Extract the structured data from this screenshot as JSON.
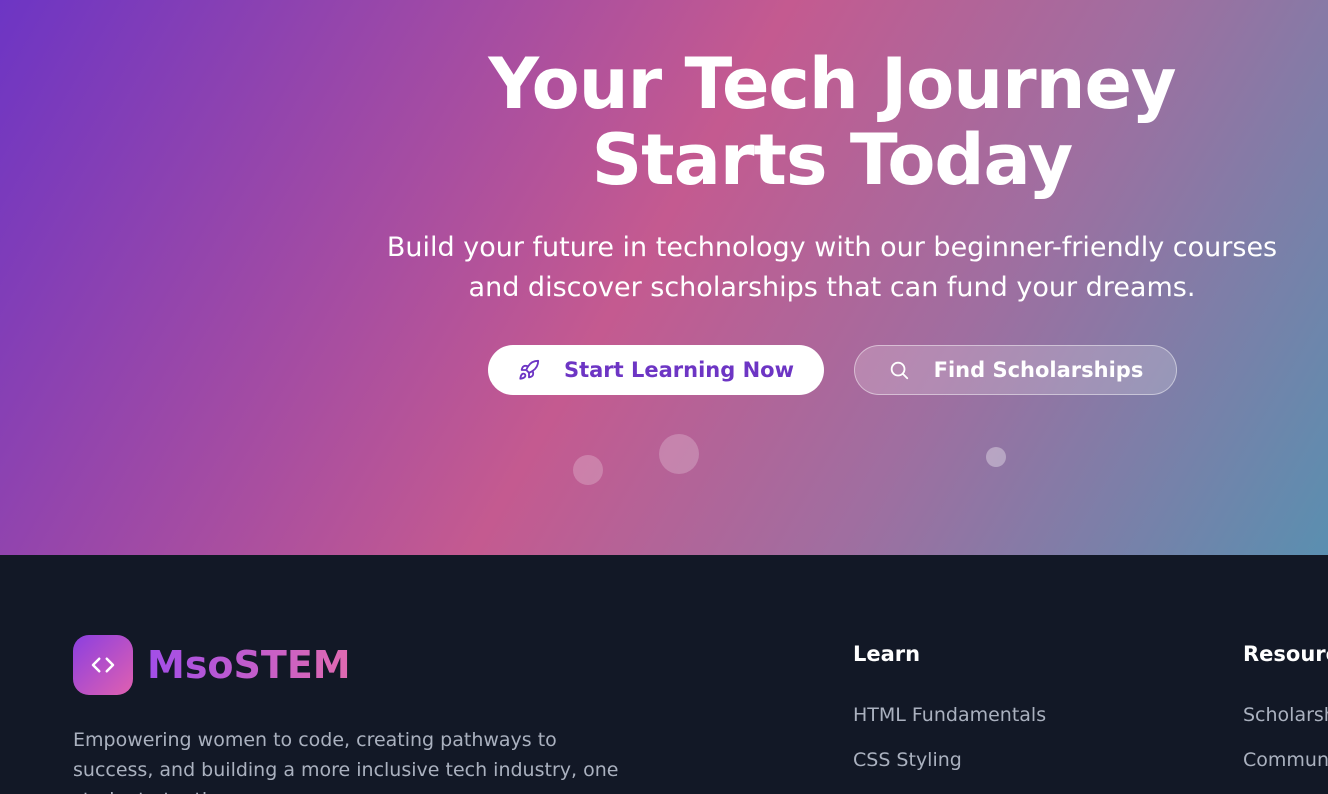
{
  "hero": {
    "title_line1": "Your Tech Journey",
    "title_line2": "Starts Today",
    "subtitle_line1": "Build your future in technology with our beginner-friendly courses",
    "subtitle_line2": "and discover scholarships that can fund your dreams.",
    "primary_button": {
      "label": "Start Learning Now",
      "icon": "rocket-icon"
    },
    "secondary_button": {
      "label": "Find Scholarships",
      "icon": "search-icon"
    }
  },
  "footer": {
    "brand": {
      "name": "MsoSTEM",
      "icon": "code-icon"
    },
    "tagline": "Empowering women to code, creating pathways to success, and building a more inclusive tech industry, one student at a time.",
    "columns": [
      {
        "title": "Learn",
        "links": [
          "HTML Fundamentals",
          "CSS Styling"
        ]
      },
      {
        "title": "Resources",
        "links": [
          "Scholarships",
          "Community"
        ]
      }
    ]
  },
  "colors": {
    "accent": "#6d35c4",
    "footer_bg": "#121826",
    "brand_gradient_start": "#a24ee8",
    "brand_gradient_end": "#e06ab0"
  }
}
